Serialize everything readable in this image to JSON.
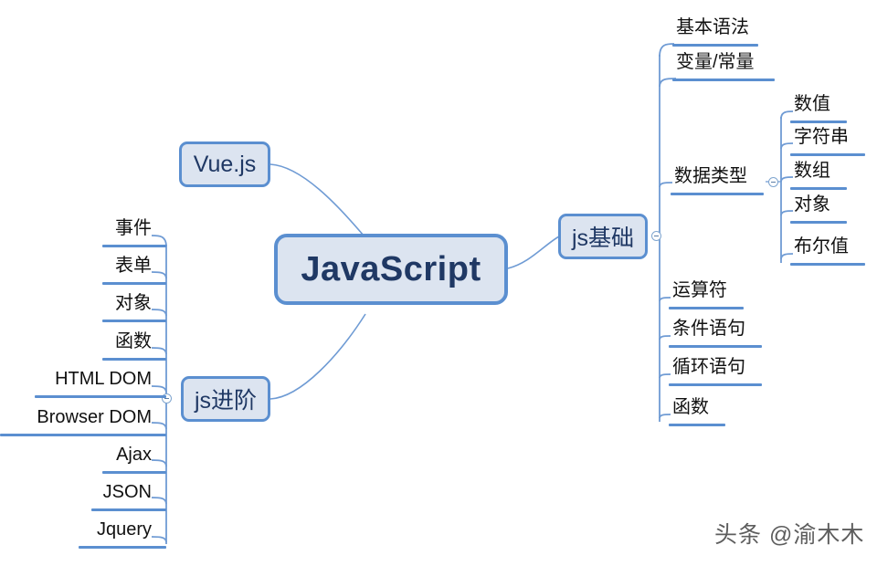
{
  "diagram": {
    "title": "JavaScript",
    "background": "#ffffff",
    "accent_color": "#5b8fd0",
    "node_fill": "#dce4f0",
    "node_text_color": "#1f3864"
  },
  "root": {
    "label": "JavaScript"
  },
  "branches": {
    "vue": {
      "label": "Vue.js"
    },
    "js_basics": {
      "label": "js基础"
    },
    "js_advanced": {
      "label": "js进阶"
    }
  },
  "js_basics_items": [
    {
      "label": "基本语法"
    },
    {
      "label": "变量/常量"
    },
    {
      "label": "数据类型"
    },
    {
      "label": "运算符"
    },
    {
      "label": "条件语句"
    },
    {
      "label": "循环语句"
    },
    {
      "label": "函数"
    }
  ],
  "data_type_items": [
    {
      "label": "数值"
    },
    {
      "label": "字符串"
    },
    {
      "label": "数组"
    },
    {
      "label": "对象"
    },
    {
      "label": "布尔值"
    }
  ],
  "js_advanced_items": [
    {
      "label": "事件"
    },
    {
      "label": "表单"
    },
    {
      "label": "对象"
    },
    {
      "label": "函数"
    },
    {
      "label": "HTML DOM"
    },
    {
      "label": "Browser DOM"
    },
    {
      "label": "Ajax"
    },
    {
      "label": "JSON"
    },
    {
      "label": "Jquery"
    }
  ],
  "toggles": {
    "js_basics": "collapse-minus",
    "data_type": "collapse-minus",
    "js_advanced": "collapse-minus"
  },
  "watermark": {
    "text": "头条 @渝木木"
  }
}
